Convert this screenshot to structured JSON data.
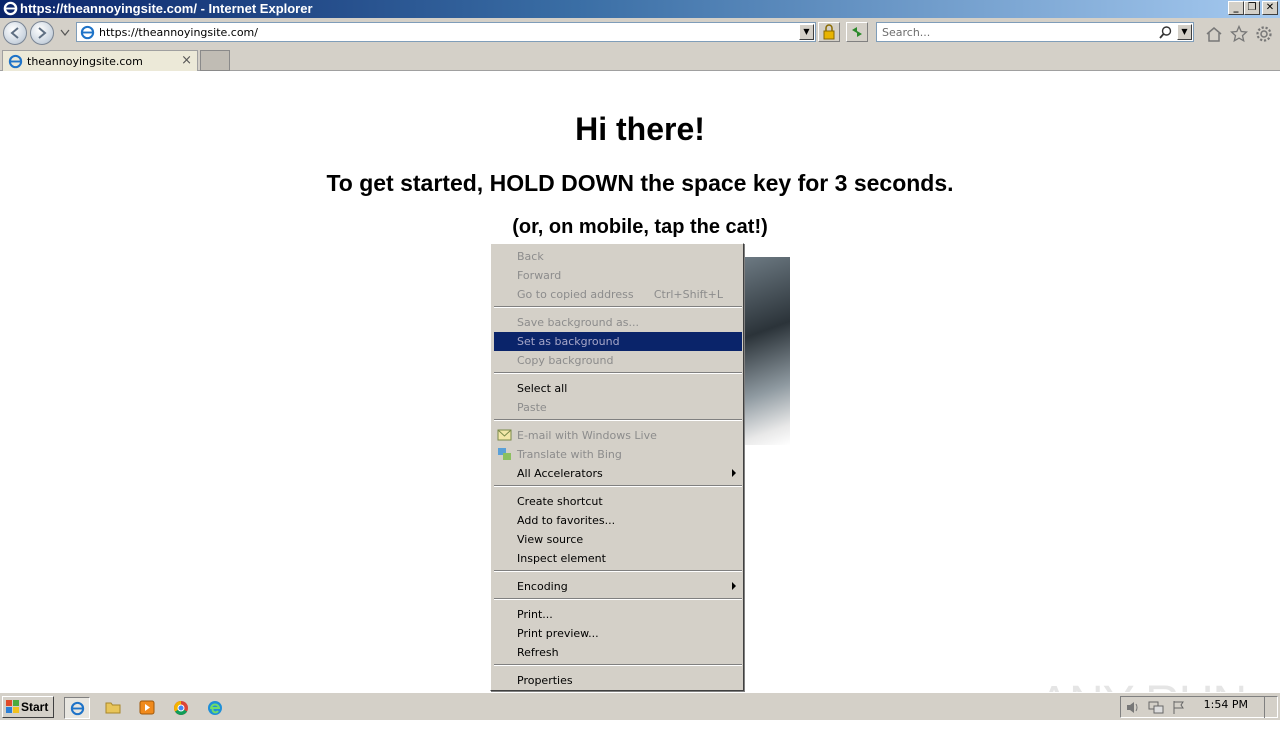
{
  "window": {
    "title": "https://theannoyingsite.com/ - Internet Explorer",
    "minimize_glyph": "_",
    "restore_glyph": "❐",
    "close_glyph": "✕"
  },
  "navbar": {
    "address_value": "https://theannoyingsite.com/",
    "search_placeholder": "Search..."
  },
  "tabs": [
    {
      "label": "theannoyingsite.com"
    }
  ],
  "page": {
    "heading": "Hi there!",
    "instruction": "To get started, HOLD DOWN the space key for 3 seconds.",
    "mobile_hint": "(or, on mobile, tap the cat!)"
  },
  "context_menu": {
    "items": [
      {
        "label": "Back",
        "disabled": true
      },
      {
        "label": "Forward",
        "disabled": true
      },
      {
        "label": "Go to copied address",
        "shortcut": "Ctrl+Shift+L",
        "disabled": true
      },
      {
        "label": "Save background as...",
        "disabled": true
      },
      {
        "label": "Set as background",
        "disabled": true,
        "highlighted": true
      },
      {
        "label": "Copy background",
        "disabled": true
      },
      {
        "label": "Select all",
        "disabled": false
      },
      {
        "label": "Paste",
        "disabled": true
      },
      {
        "label": "E-mail with Windows Live",
        "disabled": true,
        "icon": "windows-live-mail-icon"
      },
      {
        "label": "Translate with Bing",
        "disabled": true,
        "icon": "bing-translate-icon"
      },
      {
        "label": "All Accelerators",
        "disabled": false,
        "submenu": true
      },
      {
        "label": "Create shortcut",
        "disabled": false
      },
      {
        "label": "Add to favorites...",
        "disabled": false
      },
      {
        "label": "View source",
        "disabled": false
      },
      {
        "label": "Inspect element",
        "disabled": false
      },
      {
        "label": "Encoding",
        "disabled": false,
        "submenu": true
      },
      {
        "label": "Print...",
        "disabled": false
      },
      {
        "label": "Print preview...",
        "disabled": false
      },
      {
        "label": "Refresh",
        "disabled": false
      },
      {
        "label": "Properties",
        "disabled": false
      }
    ]
  },
  "taskbar": {
    "start_label": "Start",
    "clock": "1:54 PM"
  },
  "watermark": "ANY RUN",
  "colors": {
    "menu_highlight": "#0a246a",
    "chrome": "#d4d0c8"
  }
}
